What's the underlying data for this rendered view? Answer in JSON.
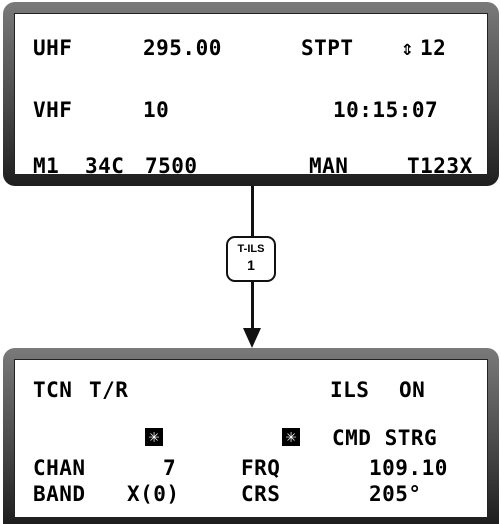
{
  "top_display": {
    "row1": {
      "uhf_label": "UHF",
      "uhf_freq": "295.00",
      "stpt_label": "STPT",
      "stpt_arrow": "⇕",
      "stpt_num": "12"
    },
    "row2": {
      "vhf_label": "VHF",
      "vhf_value": "10",
      "time": "10:15:07"
    },
    "row3": {
      "m1": "M1",
      "code1": "34C",
      "code2": "7500",
      "mode": "MAN",
      "tacan": "T123X"
    }
  },
  "button": {
    "label": "T-ILS",
    "number": "1"
  },
  "bottom_display": {
    "row1": {
      "tcn": "TCN",
      "tr": "T/R",
      "ils": "ILS",
      "ils_state": "ON"
    },
    "row2": {
      "asterisk1": "✳",
      "asterisk2": "✳",
      "cmd_strg": "CMD STRG"
    },
    "row3": {
      "chan_label": "CHAN",
      "chan_value": "7",
      "frq_label": "FRQ",
      "frq_value": "109.10"
    },
    "row4": {
      "band_label": "BAND",
      "band_value": "X(0)",
      "crs_label": "CRS",
      "crs_value": "205°"
    }
  }
}
